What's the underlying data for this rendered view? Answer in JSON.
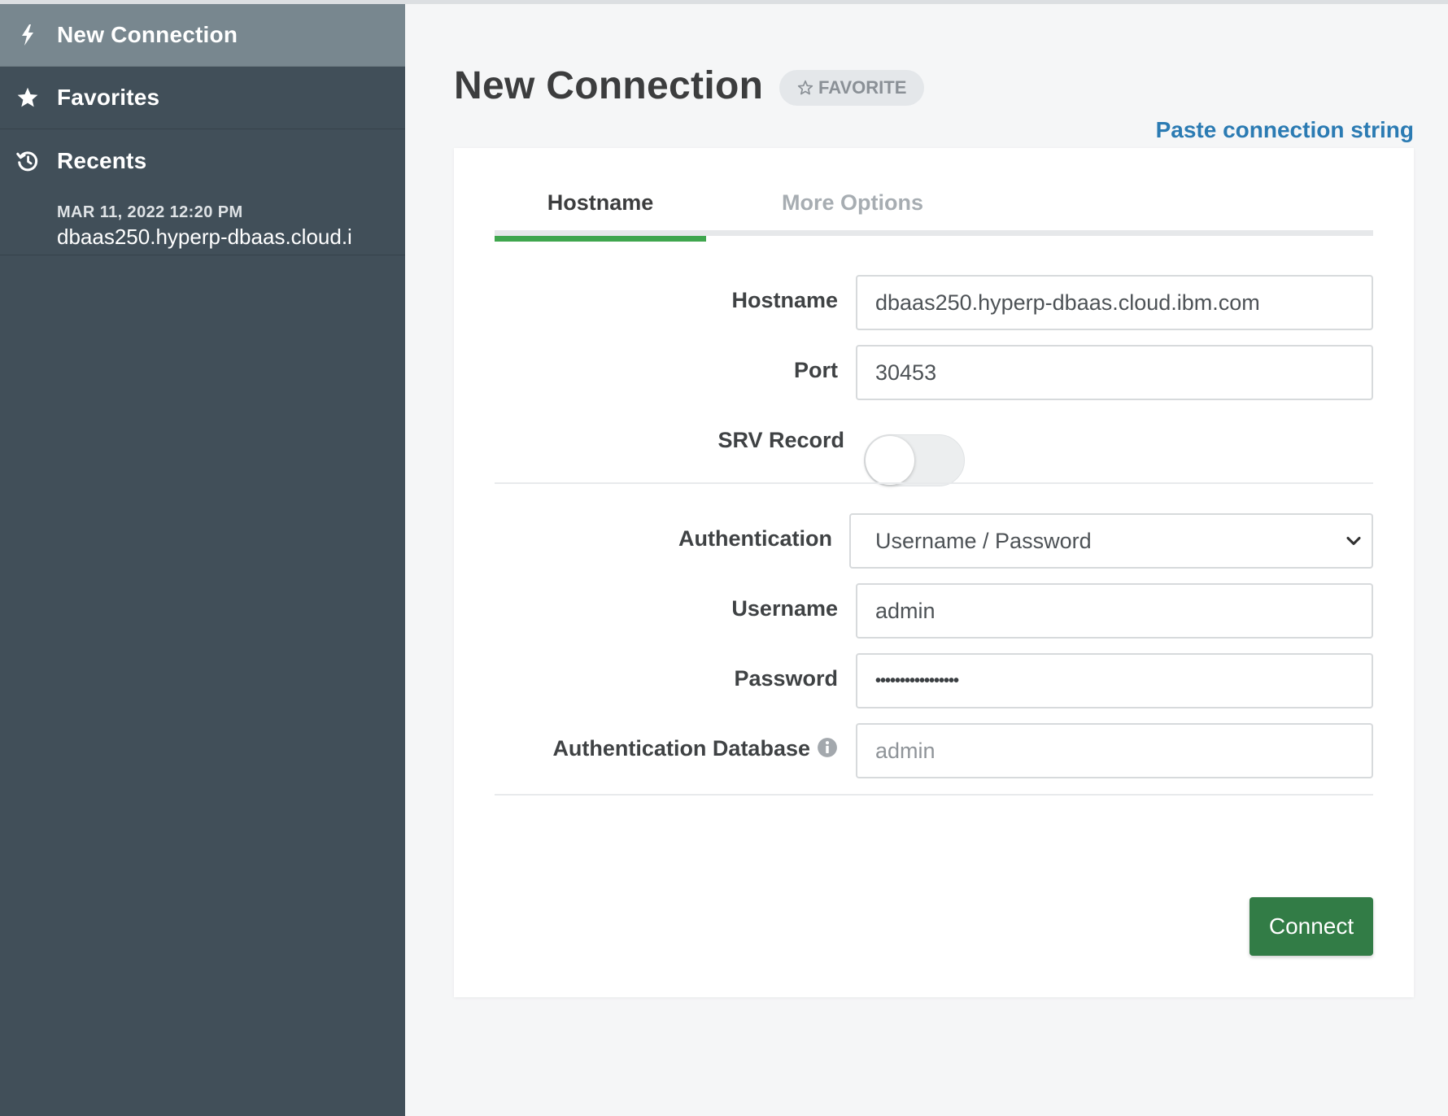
{
  "sidebar": {
    "items": [
      {
        "label": "New Connection",
        "icon": "bolt-icon"
      },
      {
        "label": "Favorites",
        "icon": "star-icon"
      },
      {
        "label": "Recents",
        "icon": "history-icon"
      }
    ],
    "recents": [
      {
        "timestamp": "MAR 11, 2022 12:20 PM",
        "host": "dbaas250.hyperp-dbaas.cloud.i"
      }
    ]
  },
  "header": {
    "title": "New Connection",
    "favorite_label": "FAVORITE",
    "paste_link": "Paste connection string"
  },
  "tabs": [
    {
      "label": "Hostname",
      "active": true
    },
    {
      "label": "More Options",
      "active": false
    }
  ],
  "form": {
    "hostname": {
      "label": "Hostname",
      "value": "dbaas250.hyperp-dbaas.cloud.ibm.com"
    },
    "port": {
      "label": "Port",
      "value": "30453"
    },
    "srv_record": {
      "label": "SRV Record",
      "enabled": false
    },
    "authentication": {
      "label": "Authentication",
      "selected": "Username / Password"
    },
    "username": {
      "label": "Username",
      "value": "admin"
    },
    "password": {
      "label": "Password",
      "masked": "•••••••••••••••••"
    },
    "auth_database": {
      "label": "Authentication Database",
      "placeholder": "admin"
    }
  },
  "actions": {
    "connect_label": "Connect"
  },
  "colors": {
    "sidebar_bg": "#414f59",
    "sidebar_active": "#78878f",
    "tab_accent": "#3fa64e",
    "link": "#2b7bb3",
    "connect_button": "#327c46"
  }
}
